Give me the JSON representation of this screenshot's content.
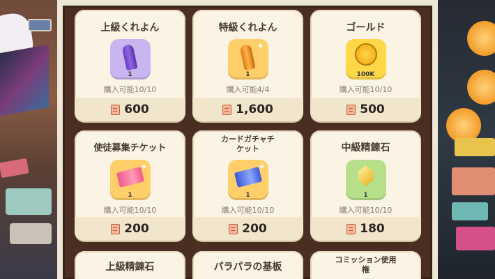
{
  "shop": {
    "items": [
      {
        "name": "上級くれよん",
        "qty": "1",
        "limit": "購入可能10/10",
        "price": "600",
        "icon": "purple-crayon-icon",
        "bg": "#c9b6f0"
      },
      {
        "name": "特級くれよん",
        "qty": "1",
        "limit": "購入可能4/4",
        "price": "1,600",
        "icon": "orange-crayon-icon",
        "bg": "#ffcf6a"
      },
      {
        "name": "ゴールド",
        "qty": "100K",
        "limit": "購入可能10/10",
        "price": "500",
        "icon": "gold-coin-icon",
        "bg": "#ffd84a"
      },
      {
        "name": "使徒募集チケット",
        "qty": "1",
        "limit": "購入可能10/10",
        "price": "200",
        "icon": "pink-ticket-icon",
        "bg": "#ffcf6a"
      },
      {
        "name_line1": "カードガチャチ",
        "name_line2": "ケット",
        "qty": "1",
        "limit": "購入可能10/10",
        "price": "200",
        "icon": "blue-ticket-icon",
        "bg": "#ffcf6a"
      },
      {
        "name": "中級精錬石",
        "qty": "1",
        "limit": "購入可能10/10",
        "price": "180",
        "icon": "yellow-gem-icon",
        "bg": "#b8e08a"
      },
      {
        "name": "上級精錬石"
      },
      {
        "name": "パラパラの基板"
      },
      {
        "name_line1": "コミッション使用",
        "name_line2": "権"
      }
    ]
  }
}
